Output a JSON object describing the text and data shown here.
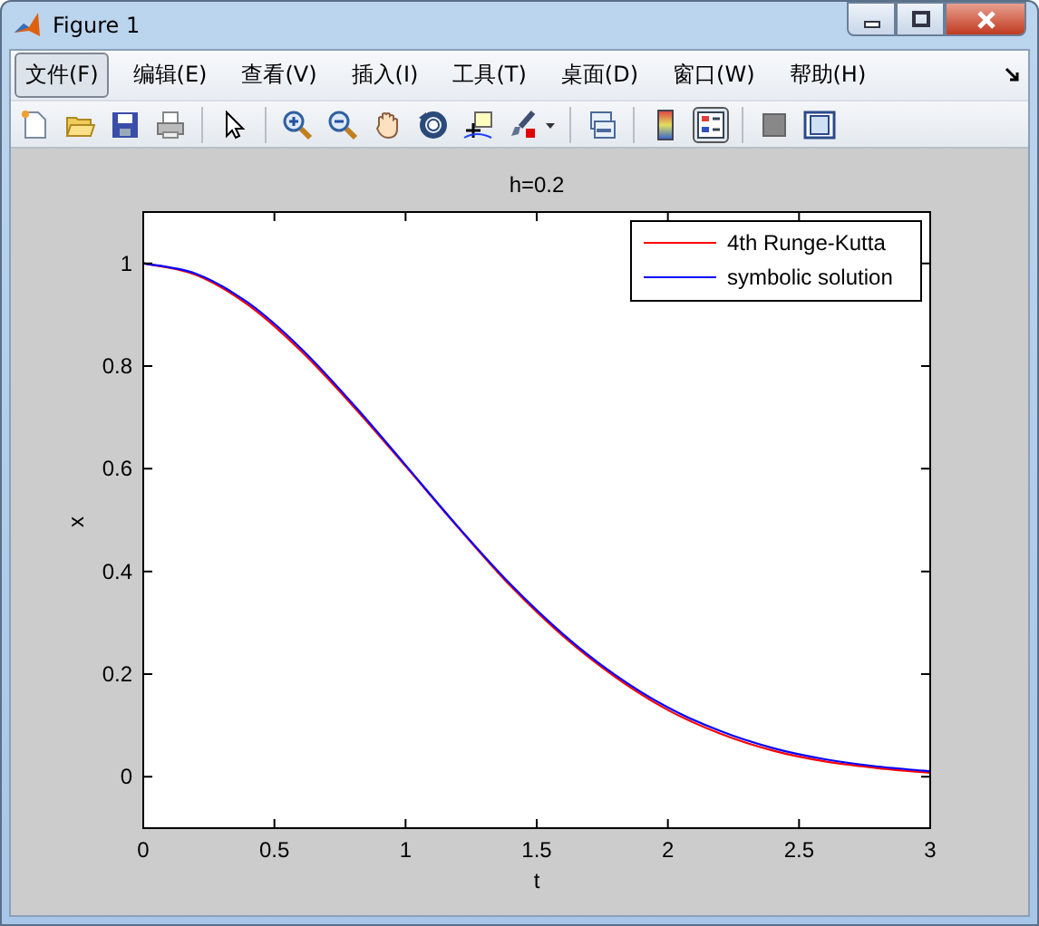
{
  "window": {
    "title": "Figure 1"
  },
  "menu": [
    {
      "label": "文件(F)",
      "selected": true
    },
    {
      "label": "编辑(E)",
      "selected": false
    },
    {
      "label": "查看(V)",
      "selected": false
    },
    {
      "label": "插入(I)",
      "selected": false
    },
    {
      "label": "工具(T)",
      "selected": false
    },
    {
      "label": "桌面(D)",
      "selected": false
    },
    {
      "label": "窗口(W)",
      "selected": false
    },
    {
      "label": "帮助(H)",
      "selected": false
    }
  ],
  "toolbar": [
    {
      "kind": "new",
      "pressed": false
    },
    {
      "kind": "open",
      "pressed": false
    },
    {
      "kind": "save",
      "pressed": false
    },
    {
      "kind": "print",
      "pressed": false
    },
    {
      "kind": "sep"
    },
    {
      "kind": "pointer",
      "pressed": false
    },
    {
      "kind": "sep"
    },
    {
      "kind": "zoomin",
      "pressed": false
    },
    {
      "kind": "zoomout",
      "pressed": false
    },
    {
      "kind": "pan",
      "pressed": false
    },
    {
      "kind": "rotate",
      "pressed": false
    },
    {
      "kind": "datacursor",
      "pressed": false
    },
    {
      "kind": "brush",
      "pressed": false
    },
    {
      "kind": "caret"
    },
    {
      "kind": "sep"
    },
    {
      "kind": "link",
      "pressed": false
    },
    {
      "kind": "sep"
    },
    {
      "kind": "colorbar",
      "pressed": false
    },
    {
      "kind": "legend",
      "pressed": true
    },
    {
      "kind": "sep"
    },
    {
      "kind": "hide",
      "pressed": false
    },
    {
      "kind": "plottools",
      "pressed": false
    }
  ],
  "chart_data": {
    "type": "line",
    "title": "h=0.2",
    "xlabel": "t",
    "ylabel": "x",
    "x": [
      0,
      0.2,
      0.4,
      0.6,
      0.8,
      1,
      1.2,
      1.4,
      1.6,
      1.8,
      2,
      2.2,
      2.4,
      2.6,
      2.8,
      3
    ],
    "series": [
      {
        "name": "4th Runge-Kutta",
        "color": "#ff0000",
        "values": [
          1,
          0.978,
          0.919,
          0.83,
          0.722,
          0.605,
          0.486,
          0.372,
          0.274,
          0.194,
          0.13,
          0.084,
          0.051,
          0.03,
          0.017,
          0.008
        ]
      },
      {
        "name": "symbolic solution",
        "color": "#0000ff",
        "values": [
          1,
          0.98,
          0.923,
          0.835,
          0.726,
          0.607,
          0.487,
          0.375,
          0.278,
          0.198,
          0.135,
          0.089,
          0.056,
          0.034,
          0.02,
          0.011
        ]
      }
    ],
    "legend": "top right",
    "xlim": [
      0,
      3
    ],
    "ylim": [
      -0.1,
      1.1
    ],
    "xticks": [
      0,
      0.5,
      1,
      1.5,
      2,
      2.5,
      3
    ],
    "yticks": [
      0,
      0.2,
      0.4,
      0.6,
      0.8,
      1
    ]
  }
}
